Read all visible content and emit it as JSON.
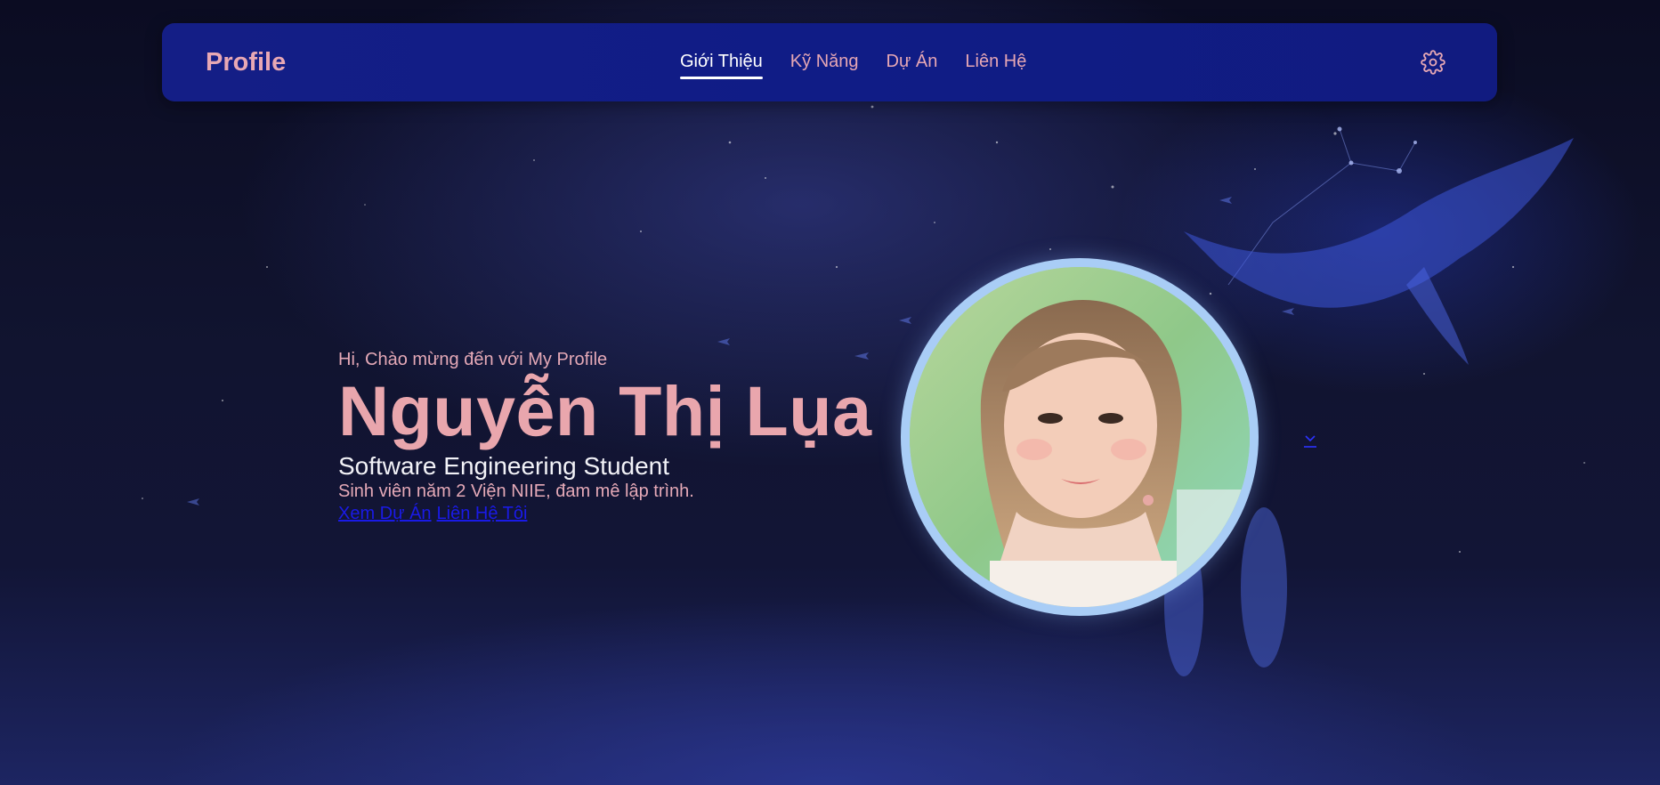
{
  "nav": {
    "brand": "Profile",
    "items": [
      {
        "label": "Giới Thiệu",
        "active": true
      },
      {
        "label": "Kỹ Năng",
        "active": false
      },
      {
        "label": "Dự Án",
        "active": false
      },
      {
        "label": "Liên Hệ",
        "active": false
      }
    ],
    "settings_icon": "gear-icon"
  },
  "hero": {
    "greeting": "Hi, Chào mừng đến với My Profile",
    "name": "Nguyễn Thị Lụa",
    "role": "Software Engineering Student",
    "description": "Sinh viên năm 2 Viện NIIE, đam mê lập trình.",
    "links": [
      "Xem Dự Án",
      "Liên Hệ Tôi"
    ]
  },
  "avatar": {
    "icon": "profile-photo"
  },
  "scroll_icon": "chevron-down-icon",
  "colors": {
    "nav_bg": "#121c84",
    "accent_pink": "#e9a6ad",
    "link_blue": "#1a1ae6",
    "avatar_ring": "#a9cdf6"
  }
}
